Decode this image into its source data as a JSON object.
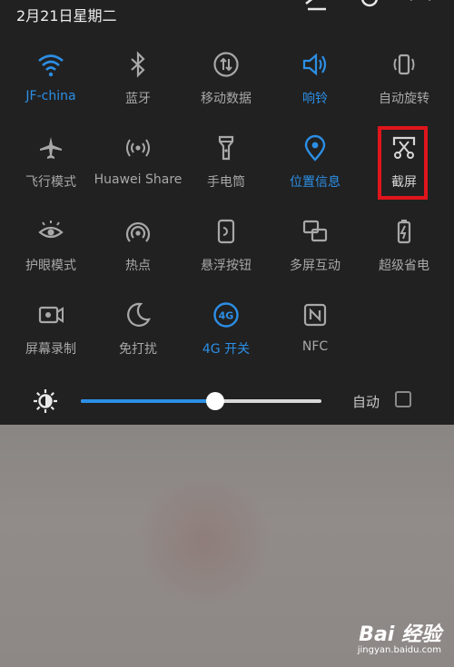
{
  "status_bar": {
    "date": "2月21日星期二"
  },
  "tiles": [
    {
      "label": "JF-china",
      "icon": "wifi-icon",
      "active": true
    },
    {
      "label": "蓝牙",
      "icon": "bluetooth-icon",
      "active": false
    },
    {
      "label": "移动数据",
      "icon": "mobile-data-icon",
      "active": false
    },
    {
      "label": "响铃",
      "icon": "ringer-icon",
      "active": true
    },
    {
      "label": "自动旋转",
      "icon": "auto-rotate-icon",
      "active": false
    },
    {
      "label": "飞行模式",
      "icon": "airplane-icon",
      "active": false
    },
    {
      "label": "Huawei Share",
      "icon": "huawei-share-icon",
      "active": false
    },
    {
      "label": "手电筒",
      "icon": "flashlight-icon",
      "active": false
    },
    {
      "label": "位置信息",
      "icon": "location-icon",
      "active": true
    },
    {
      "label": "截屏",
      "icon": "screenshot-icon",
      "active": false
    },
    {
      "label": "护眼模式",
      "icon": "eye-comfort-icon",
      "active": false
    },
    {
      "label": "热点",
      "icon": "hotspot-icon",
      "active": false
    },
    {
      "label": "悬浮按钮",
      "icon": "floating-button-icon",
      "active": false
    },
    {
      "label": "多屏互动",
      "icon": "multi-screen-icon",
      "active": false
    },
    {
      "label": "超级省电",
      "icon": "battery-saver-icon",
      "active": false
    },
    {
      "label": "屏幕录制",
      "icon": "screen-record-icon",
      "active": false
    },
    {
      "label": "免打扰",
      "icon": "do-not-disturb-icon",
      "active": false
    },
    {
      "label": "4G 开关",
      "icon": "4g-icon",
      "active": true
    },
    {
      "label": "NFC",
      "icon": "nfc-icon",
      "active": false
    }
  ],
  "brightness": {
    "level": 0.56,
    "auto_label": "自动",
    "auto_checked": false
  },
  "watermark": {
    "logo": "Bai 经验",
    "url": "jingyan.baidu.com"
  },
  "colors": {
    "accent": "#2c8fe6",
    "panel_bg": "#212121",
    "highlight": "#e0151b"
  }
}
